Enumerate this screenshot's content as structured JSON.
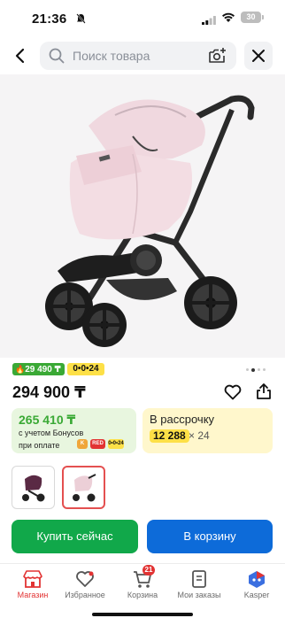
{
  "status_bar": {
    "time": "21:36",
    "battery": "30"
  },
  "search": {
    "placeholder": "Поиск товара"
  },
  "product": {
    "badges": {
      "bonus": "29 490 ₸",
      "installment": "0•0•24"
    },
    "price": "294 900 ₸",
    "bonus_offer": {
      "price": "265 410 ₸",
      "line1": "с учетом Бонусов",
      "line2": "при оплате",
      "pay_icons": {
        "kaspi": "K",
        "red": "RED",
        "installment": "0•0•24"
      }
    },
    "installment_offer": {
      "title": "В рассрочку",
      "amount": "12 288",
      "multiplier": "× 24"
    }
  },
  "buttons": {
    "buy_now": "Купить сейчас",
    "add_to_cart": "В корзину"
  },
  "bottom_nav": [
    {
      "label": "Магазин",
      "icon": "shop-icon",
      "active": true
    },
    {
      "label": "Избранное",
      "icon": "heart-icon"
    },
    {
      "label": "Корзина",
      "icon": "cart-icon",
      "count": "21"
    },
    {
      "label": "Мои заказы",
      "icon": "orders-icon"
    },
    {
      "label": "Kasper",
      "icon": "kasper-icon"
    }
  ],
  "colors": {
    "green": "#11a84a",
    "blue": "#0d6bd9",
    "yellow": "#fde047",
    "red": "#e23333"
  }
}
